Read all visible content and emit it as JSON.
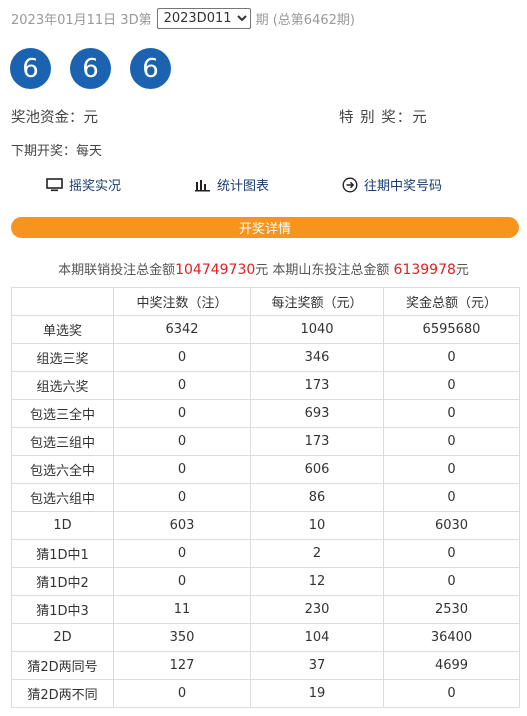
{
  "header": {
    "date_prefix": "2023年01月11日 3D第",
    "issue_selected": "2023D011",
    "suffix": "期 (总第6462期)"
  },
  "balls": [
    "6",
    "6",
    "6"
  ],
  "pool_label": "奖池资金：元",
  "special_label": "特 别 奖：元",
  "next_draw": "下期开奖：每天",
  "links": {
    "live": "摇奖实况",
    "chart": "统计图表",
    "history": "往期中奖号码"
  },
  "detail_bar": "开奖详情",
  "summary": {
    "text1": "本期联销投注总金额",
    "amount1": "104749730",
    "text2": "元 本期山东投注总金额 ",
    "amount2": "6139978",
    "text3": "元"
  },
  "table": {
    "headers": [
      "",
      "中奖注数（注）",
      "每注奖额（元）",
      "奖金总额（元）"
    ],
    "rows": [
      [
        "单选奖",
        "6342",
        "1040",
        "6595680"
      ],
      [
        "组选三奖",
        "0",
        "346",
        "0"
      ],
      [
        "组选六奖",
        "0",
        "173",
        "0"
      ],
      [
        "包选三全中",
        "0",
        "693",
        "0"
      ],
      [
        "包选三组中",
        "0",
        "173",
        "0"
      ],
      [
        "包选六全中",
        "0",
        "606",
        "0"
      ],
      [
        "包选六组中",
        "0",
        "86",
        "0"
      ],
      [
        "1D",
        "603",
        "10",
        "6030"
      ],
      [
        "猜1D中1",
        "0",
        "2",
        "0"
      ],
      [
        "猜1D中2",
        "0",
        "12",
        "0"
      ],
      [
        "猜1D中3",
        "11",
        "230",
        "2530"
      ],
      [
        "2D",
        "350",
        "104",
        "36400"
      ],
      [
        "猜2D两同号",
        "127",
        "37",
        "4699"
      ],
      [
        "猜2D两不同",
        "0",
        "19",
        "0"
      ]
    ]
  },
  "colors": {
    "ball": "#1b63b0",
    "detail_bar": "#f7941d",
    "amount": "#e02020",
    "link": "#1a3d6e"
  },
  "icons": [
    "monitor-icon",
    "bar-chart-icon",
    "arrow-circle-icon"
  ]
}
